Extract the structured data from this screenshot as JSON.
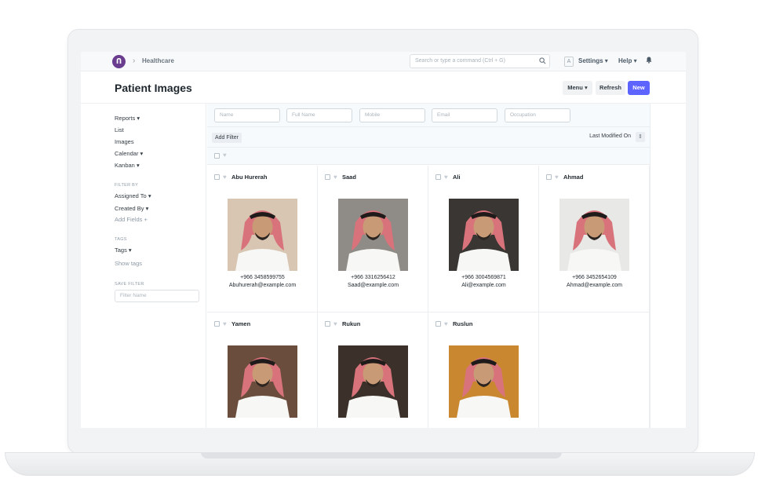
{
  "navbar": {
    "breadcrumb": "Healthcare",
    "search_placeholder": "Search or type a command (Ctrl + G)",
    "avatar_letter": "A",
    "settings_label": "Settings",
    "help_label": "Help"
  },
  "page": {
    "title": "Patient Images",
    "menu_label": "Menu",
    "refresh_label": "Refresh",
    "new_label": "New"
  },
  "sidebar": {
    "items": [
      "Reports",
      "List",
      "Images",
      "Calendar",
      "Kanban"
    ],
    "filter_by_label": "FILTER BY",
    "assigned_to": "Assigned To",
    "created_by": "Created By",
    "add_fields": "Add Fields",
    "tags_label": "TAGS",
    "tags_item": "Tags",
    "show_tags": "Show tags",
    "save_filter_label": "SAVE FILTER",
    "filter_name_placeholder": "Filter Name"
  },
  "filters": {
    "placeholders": [
      "Name",
      "Full Name",
      "Mobile",
      "Email",
      "Occupation"
    ],
    "add_filter": "Add Filter",
    "sort_label": "Last Modified On"
  },
  "patients": [
    {
      "name": "Abu Hurerah",
      "phone": "+966 3458599755",
      "email": "Abuhurerah@example.com",
      "bg": "#d8c6b2"
    },
    {
      "name": "Saad",
      "phone": "+966 3316256412",
      "email": "Saad@example.com",
      "bg": "#8f8b86"
    },
    {
      "name": "Ali",
      "phone": "+966 3004569871",
      "email": "Ali@example.com",
      "bg": "#3a3633"
    },
    {
      "name": "Ahmad",
      "phone": "+966 3452654109",
      "email": "Ahmad@example.com",
      "bg": "#e8e8e6"
    },
    {
      "name": "Yamen",
      "phone": "",
      "email": "",
      "bg": "#6a4d3c"
    },
    {
      "name": "Rukun",
      "phone": "",
      "email": "",
      "bg": "#3b302a"
    },
    {
      "name": "Ruslun",
      "phone": "",
      "email": "",
      "bg": "#c9872f"
    }
  ],
  "colors": {
    "primary": "#5e64ff",
    "logo": "#6a3d8f"
  }
}
